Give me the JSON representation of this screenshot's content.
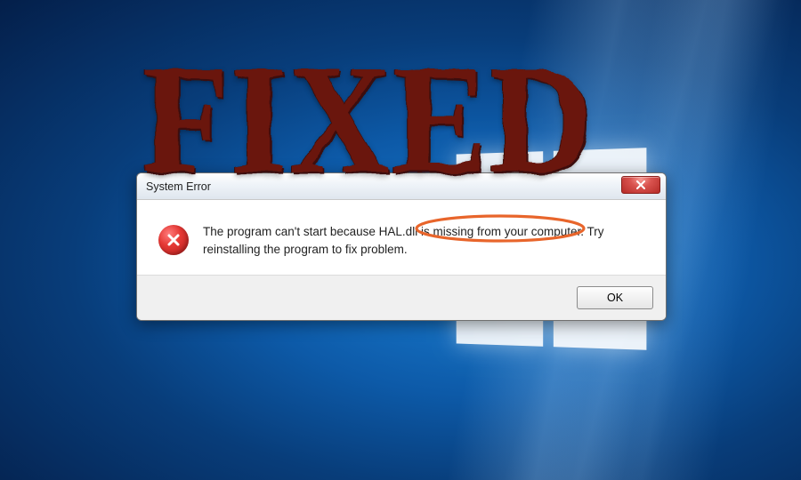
{
  "dialog": {
    "title": "System Error",
    "message": "The program can't start because HAL.dll is missing from your computer. Try reinstalling the program to fix problem.",
    "ok_label": "OK"
  },
  "overlay": {
    "stamp_text": "FIXED"
  }
}
